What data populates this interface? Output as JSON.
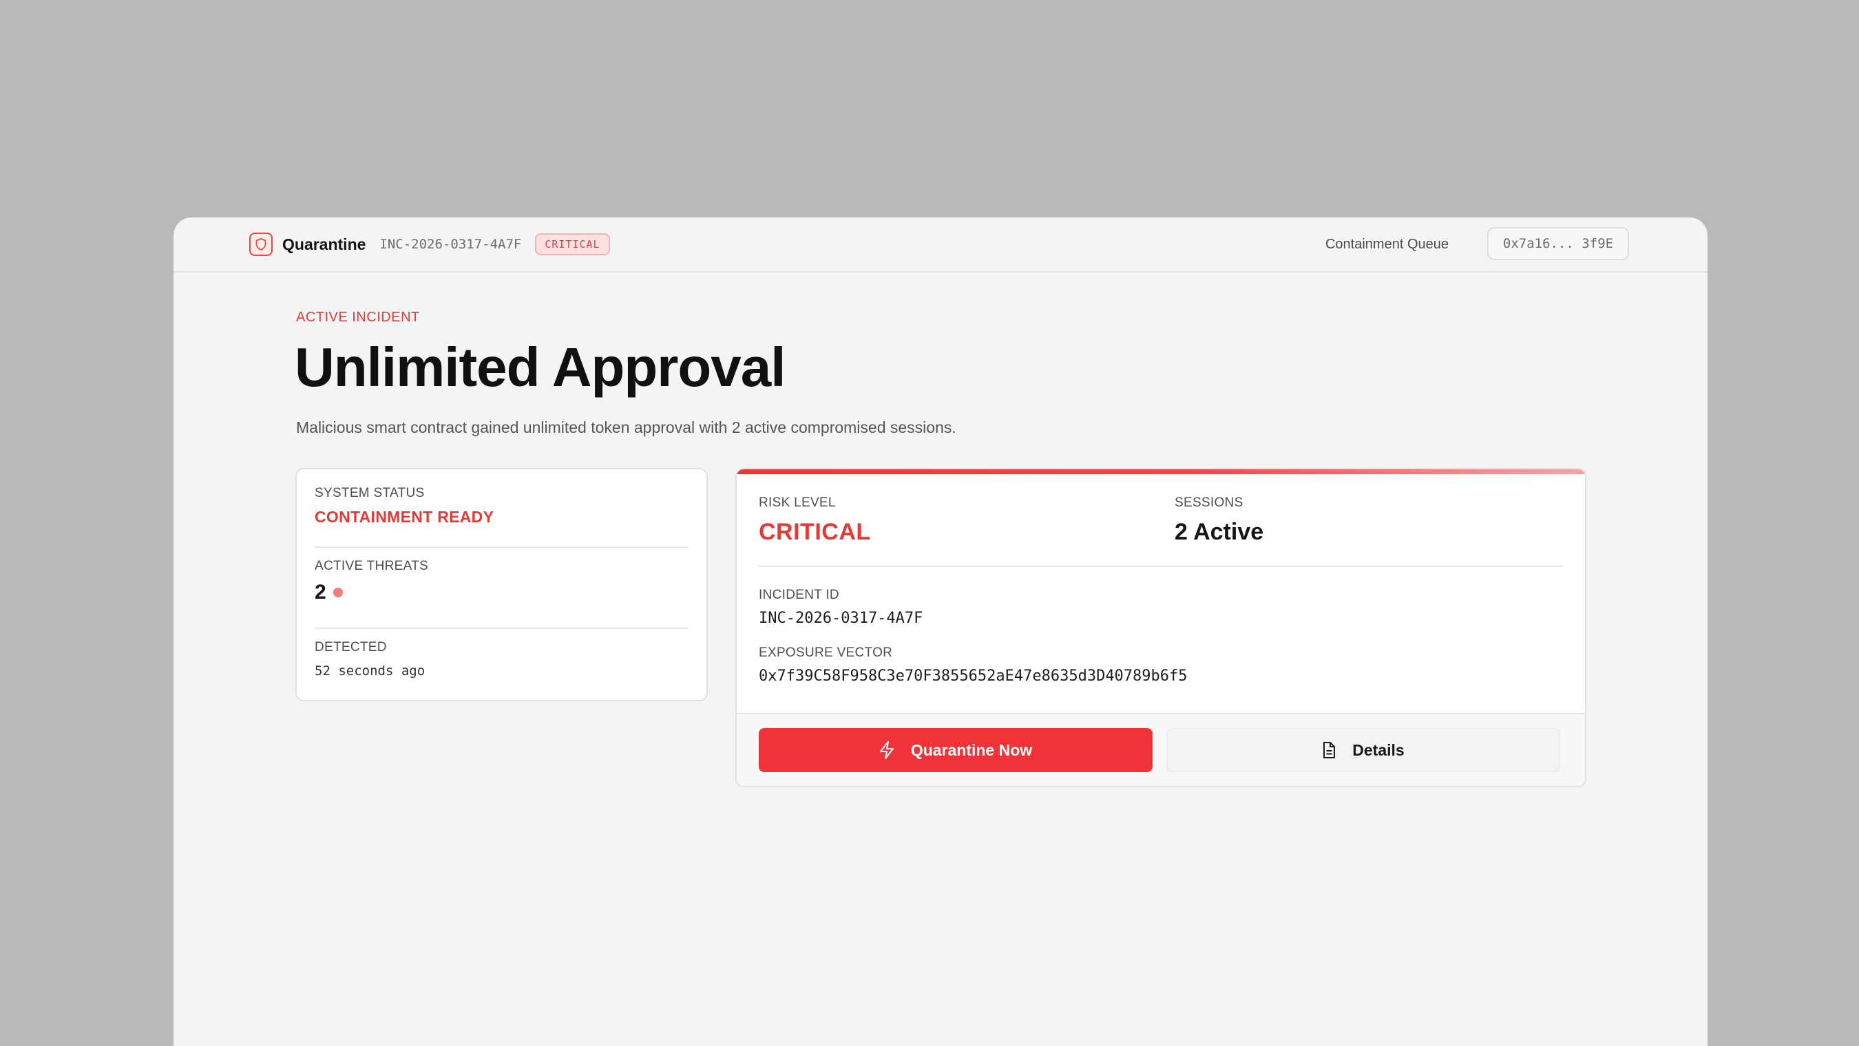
{
  "header": {
    "app_name": "Quarantine",
    "incident_id": "INC-2026-0317-4A7F",
    "severity_badge": "CRITICAL",
    "queue_label": "Containment Queue",
    "wallet_address": "0x7a16... 3f9E",
    "brand_icon": "shield-icon"
  },
  "hero": {
    "eyebrow": "ACTIVE INCIDENT",
    "title": "Unlimited Approval",
    "description": "Malicious smart contract gained unlimited token approval with 2 active compromised sessions."
  },
  "status": {
    "system_status_label": "SYSTEM STATUS",
    "system_status_value": "CONTAINMENT READY",
    "threats_label": "ACTIVE THREATS",
    "threats_value": "2",
    "detected_label": "DETECTED",
    "detected_value": "52 seconds ago"
  },
  "risk": {
    "risk_label": "RISK LEVEL",
    "risk_value": "CRITICAL",
    "sessions_label": "SESSIONS",
    "sessions_value": "2 Active",
    "incident_label": "INCIDENT ID",
    "incident_value": "INC-2026-0317-4A7F",
    "vector_label": "EXPOSURE VECTOR",
    "vector_value": "0x7f39C58F958C3e70F3855652aE47e8635d3D40789b6f5"
  },
  "actions": {
    "primary_label": "Quarantine Now",
    "primary_icon": "lightning-icon",
    "secondary_label": "Details",
    "secondary_icon": "document-icon"
  },
  "colors": {
    "accent": "#e53935",
    "background": "#f4f4f4",
    "card": "#ffffff"
  }
}
